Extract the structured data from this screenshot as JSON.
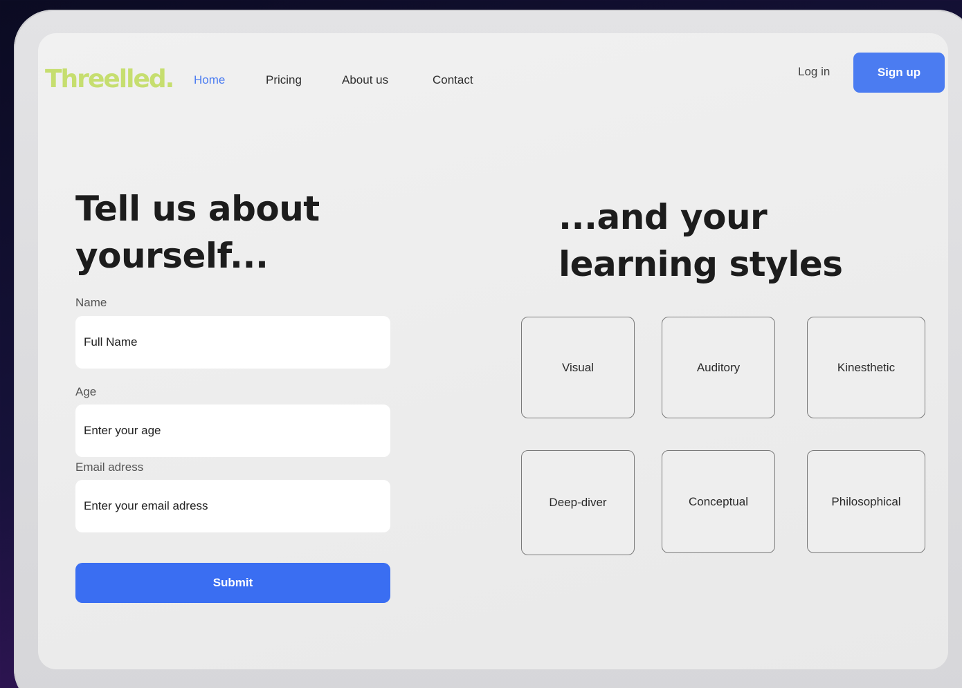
{
  "header": {
    "logo": "Threelled.",
    "nav": [
      {
        "label": "Home",
        "active": true
      },
      {
        "label": "Pricing"
      },
      {
        "label": "About us"
      },
      {
        "label": "Contact"
      }
    ],
    "login_label": "Log in",
    "signup_label": "Sign up"
  },
  "form": {
    "heading": "Tell us about yourself...",
    "fields": {
      "name": {
        "label": "Name",
        "placeholder": "Full Name"
      },
      "age": {
        "label": "Age",
        "placeholder": "Enter your age"
      },
      "email": {
        "label": "Email adress",
        "placeholder": "Enter your email adress"
      }
    },
    "submit_label": "Submit"
  },
  "styles": {
    "heading": "...and your learning styles",
    "options": [
      "Visual",
      "Auditory",
      "Kinesthetic",
      "Deep-diver",
      "Conceptual",
      "Philosophical"
    ]
  },
  "colors": {
    "logo": "#c6de6f",
    "accent": "#4b7cf1",
    "submit": "#3a6ef2"
  }
}
